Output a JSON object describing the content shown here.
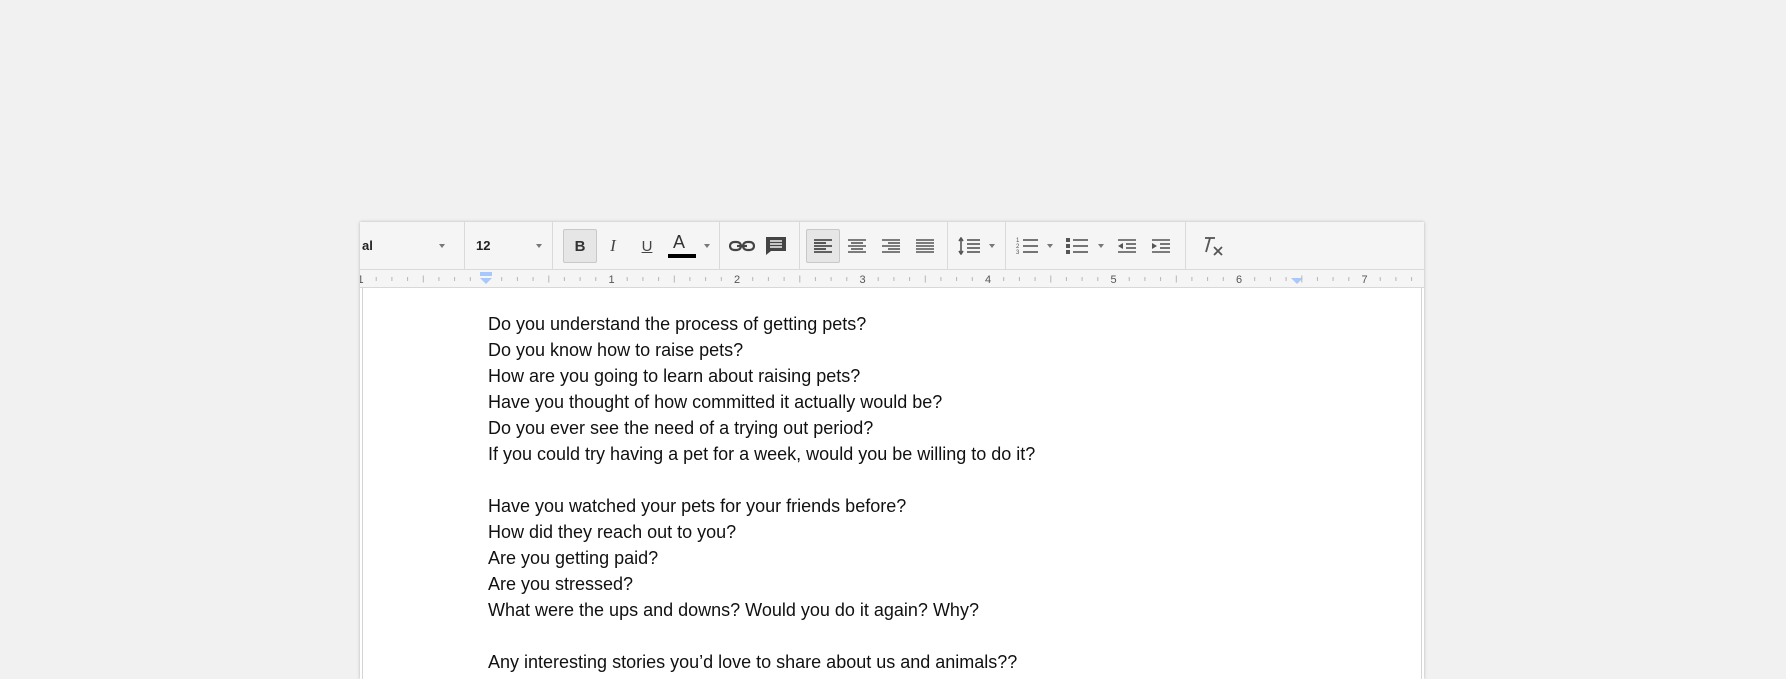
{
  "toolbar": {
    "font_name": "al",
    "font_size": "12",
    "bold_label": "B",
    "italic_label": "I",
    "underline_label": "U",
    "text_color_label": "A",
    "text_color_value": "#000000",
    "active_alignment": "left",
    "buttons": [
      {
        "name": "font-dropdown",
        "icon": "chevron-down-icon"
      },
      {
        "name": "font-size-dropdown",
        "icon": "chevron-down-icon"
      },
      {
        "name": "bold-button",
        "icon": "bold-icon",
        "active": true
      },
      {
        "name": "italic-button",
        "icon": "italic-icon"
      },
      {
        "name": "underline-button",
        "icon": "underline-icon"
      },
      {
        "name": "text-color-button",
        "icon": "text-color-icon"
      },
      {
        "name": "insert-link-button",
        "icon": "link-icon"
      },
      {
        "name": "insert-comment-button",
        "icon": "comment-icon"
      },
      {
        "name": "align-left-button",
        "icon": "align-left-icon",
        "active": true
      },
      {
        "name": "align-center-button",
        "icon": "align-center-icon"
      },
      {
        "name": "align-right-button",
        "icon": "align-right-icon"
      },
      {
        "name": "justify-button",
        "icon": "justify-icon"
      },
      {
        "name": "line-spacing-button",
        "icon": "line-spacing-icon"
      },
      {
        "name": "numbered-list-button",
        "icon": "numbered-list-icon"
      },
      {
        "name": "bulleted-list-button",
        "icon": "bulleted-list-icon"
      },
      {
        "name": "decrease-indent-button",
        "icon": "decrease-indent-icon"
      },
      {
        "name": "increase-indent-button",
        "icon": "increase-indent-icon"
      },
      {
        "name": "clear-formatting-button",
        "icon": "clear-formatting-icon"
      }
    ]
  },
  "ruler": {
    "numbers": [
      "1",
      "1",
      "2",
      "3",
      "4",
      "5",
      "6",
      "7"
    ],
    "marker_color": "#a8c7fa"
  },
  "document": {
    "lines": [
      "Do you understand the process of getting pets?",
      "Do you know how to raise pets?",
      "How are you going to learn about raising pets?",
      "Have you thought of how committed it actually would be?",
      "Do you ever see the need of a trying out period?",
      "If you could try having a pet for a week, would you be willing to do it?",
      "",
      "Have you watched your pets for your friends before?",
      "How did they reach out to you?",
      "Are you getting paid?",
      "Are you stressed?",
      "What were the ups and downs? Would you do it again? Why?",
      "",
      "Any interesting stories you’d love to share about us and animals??"
    ]
  },
  "colors": {
    "background": "#f1f1f1",
    "toolbar": "#f5f5f5",
    "page": "#ffffff",
    "text": "#111111"
  }
}
